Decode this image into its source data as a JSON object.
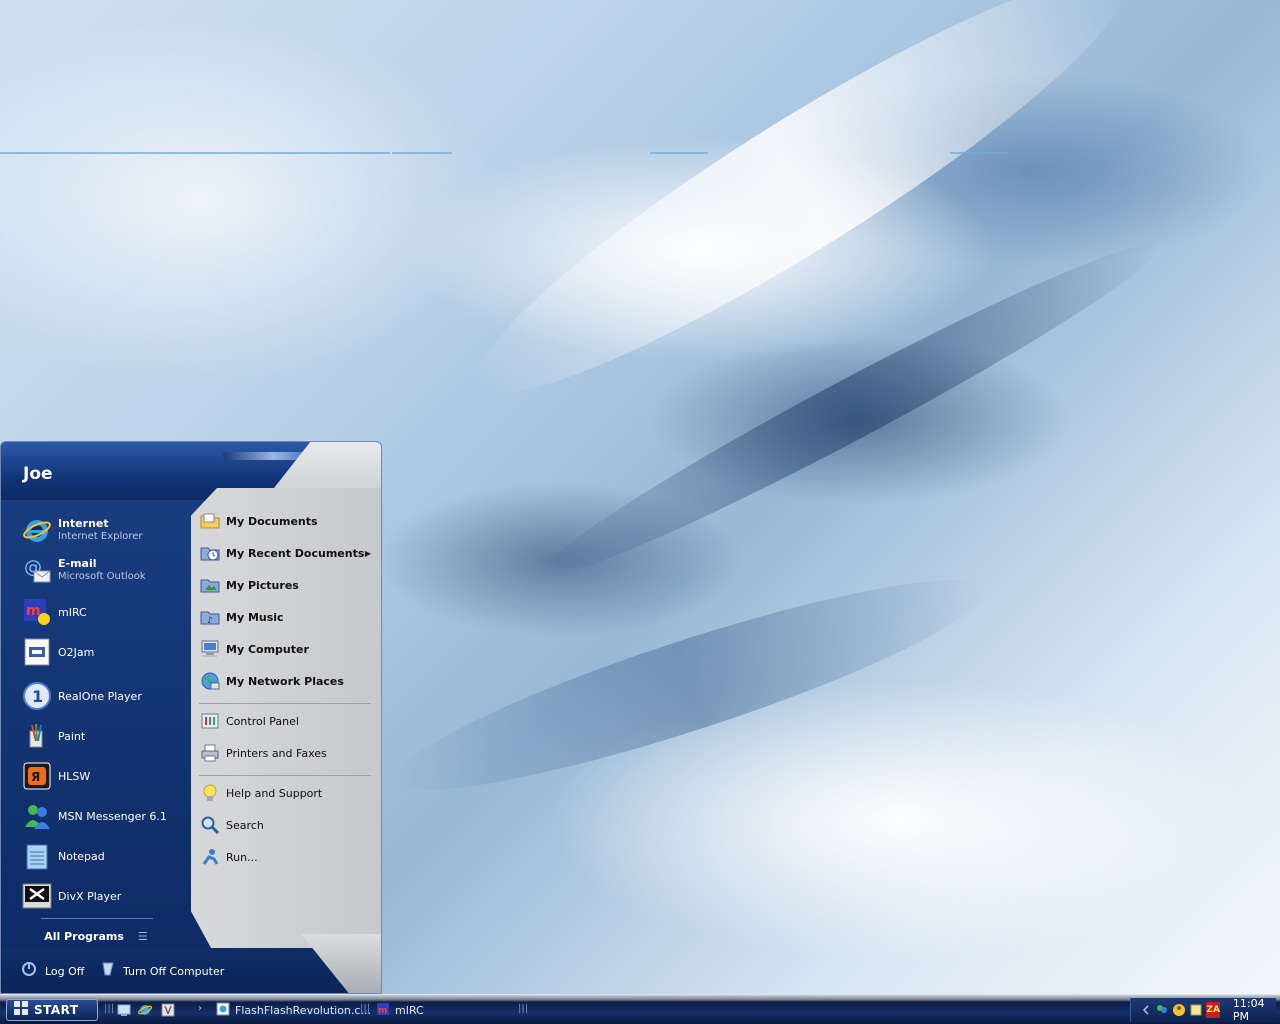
{
  "user": {
    "name": "Joe"
  },
  "pinned": [
    {
      "name": "Internet",
      "sub": "Internet Explorer",
      "icon": "internet-explorer-icon"
    },
    {
      "name": "E-mail",
      "sub": "Microsoft Outlook",
      "icon": "outlook-email-icon"
    }
  ],
  "recent": [
    {
      "name": "mIRC",
      "icon": "mirc-icon"
    },
    {
      "name": "O2Jam",
      "icon": "o2jam-icon"
    },
    {
      "name": "RealOne Player",
      "icon": "realone-player-icon"
    },
    {
      "name": "Paint",
      "icon": "paint-icon"
    },
    {
      "name": "HLSW",
      "icon": "hlsw-icon"
    },
    {
      "name": "MSN Messenger 6.1",
      "icon": "msn-messenger-icon"
    },
    {
      "name": "Notepad",
      "icon": "notepad-icon"
    },
    {
      "name": "DivX Player",
      "icon": "divx-player-icon"
    }
  ],
  "all_programs": "All Programs",
  "places": [
    {
      "label": "My Documents",
      "icon": "folder-documents-icon"
    },
    {
      "label": "My Recent Documents",
      "icon": "recent-documents-icon"
    },
    {
      "label": "My Pictures",
      "icon": "folder-pictures-icon"
    },
    {
      "label": "My Music",
      "icon": "folder-music-icon"
    },
    {
      "label": "My Computer",
      "icon": "computer-icon"
    },
    {
      "label": "My Network Places",
      "icon": "network-places-icon"
    }
  ],
  "settings": [
    {
      "label": "Control Panel",
      "icon": "control-panel-icon"
    },
    {
      "label": "Printers and Faxes",
      "icon": "printer-icon"
    }
  ],
  "tools": [
    {
      "label": "Help and Support",
      "icon": "help-bulb-icon"
    },
    {
      "label": "Search",
      "icon": "search-icon"
    },
    {
      "label": "Run...",
      "icon": "run-icon"
    }
  ],
  "footer": {
    "logoff": "Log Off",
    "turnoff": "Turn Off Computer"
  },
  "taskbar": {
    "start": "START",
    "tasks": [
      {
        "label": "FlashFlashRevolution.c...",
        "icon": "ie-page-icon"
      },
      {
        "label": "mIRC",
        "icon": "mirc-icon"
      }
    ],
    "clock": "11:04 PM",
    "tray_badge": "ZA"
  },
  "colors": {
    "menu_blue": "#12357a",
    "panel_gray": "#c6c8cb",
    "taskbar_navy": "#16306a"
  }
}
